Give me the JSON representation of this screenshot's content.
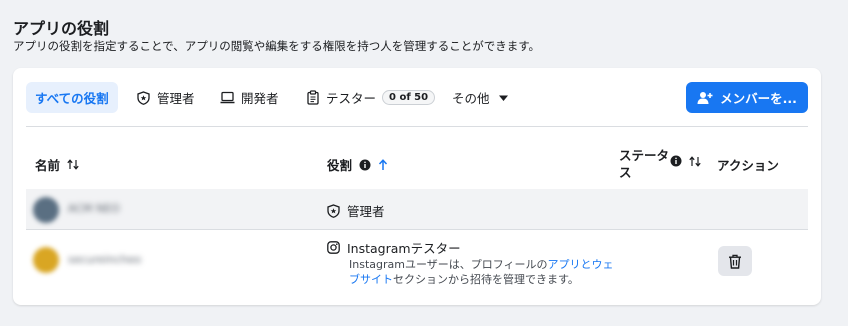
{
  "header": {
    "title": "アプリの役割",
    "subtitle": "アプリの役割を指定することで、アプリの閲覧や編集をする権限を持つ人を管理することができます。"
  },
  "tabs": [
    {
      "label": "すべての役割",
      "icon": "none",
      "active": true
    },
    {
      "label": "管理者",
      "icon": "shield-star-icon"
    },
    {
      "label": "開発者",
      "icon": "laptop-icon"
    },
    {
      "label": "テスター",
      "icon": "clipboard-icon",
      "badge": "0 of 50"
    },
    {
      "label": "その他",
      "icon": "caret-down-icon"
    }
  ],
  "add_member_button": {
    "label": "メンバーを...",
    "icon": "add-person-icon"
  },
  "table": {
    "columns": [
      {
        "label": "名前",
        "icon": "sort-both-icon"
      },
      {
        "label": "役割",
        "icon": "sort-asc-icon",
        "info": true
      },
      {
        "label": "ステータス",
        "icon": "sort-both-icon",
        "info": true
      },
      {
        "label": "アクション"
      }
    ],
    "rows": [
      {
        "avatar_color": "#5a6f82",
        "name": "ACM NEO",
        "role": "管理者",
        "role_icon": "shield-star-icon"
      },
      {
        "avatar_color": "#d9a623",
        "name": "secureincheo",
        "role": "Instagramテスター",
        "role_icon": "instagram-icon",
        "desc_before": "Instagramユーザーは、プロフィールの",
        "desc_link": "アプリとウェブサイト",
        "desc_after": "セクションから招待を管理できます。",
        "action": "trash-icon"
      }
    ]
  },
  "colors": {
    "accent": "#1877f2",
    "page_bg": "#f0f2f5"
  }
}
